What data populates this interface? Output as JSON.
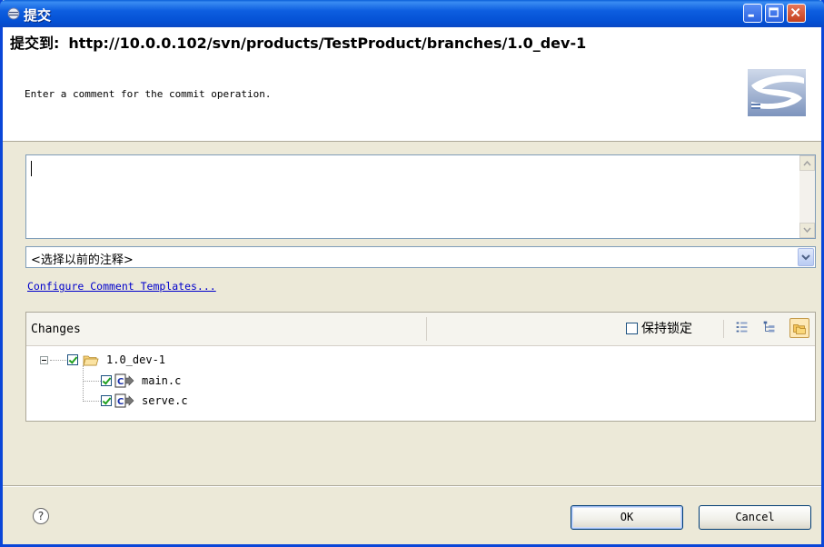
{
  "window": {
    "title": "提交"
  },
  "header": {
    "title_prefix": "提交到:",
    "url": "http://10.0.0.102/svn/products/TestProduct/branches/1.0_dev-1",
    "description": "Enter a comment for the commit operation."
  },
  "comment": {
    "value": "",
    "previous_comments": "<选择以前的注释>"
  },
  "templates_link": "Configure Comment Templates...",
  "changes": {
    "title": "Changes",
    "keep_locks_label": "保持锁定",
    "keep_locks_checked": false,
    "tree": [
      {
        "label": "1.0_dev-1",
        "type": "folder",
        "checked": true,
        "expanded": true
      },
      {
        "label": "main.c",
        "type": "c-file",
        "checked": true
      },
      {
        "label": "serve.c",
        "type": "c-file",
        "checked": true
      }
    ]
  },
  "buttons": {
    "ok": "OK",
    "cancel": "Cancel"
  },
  "colors": {
    "titlebar": "#0a5fd8",
    "dialog_bg": "#ece9d8",
    "link": "#0000cc",
    "check": "#21a121"
  },
  "icons": [
    "eclipse-window-icon",
    "minimize-icon",
    "maximize-icon",
    "close-icon",
    "svn-logo-icon",
    "scroll-up-icon",
    "scroll-down-icon",
    "chevron-down-icon",
    "flat-layout-icon",
    "tree-layout-icon",
    "compressed-folders-icon",
    "collapse-icon",
    "folder-icon",
    "c-file-icon",
    "help-icon"
  ]
}
